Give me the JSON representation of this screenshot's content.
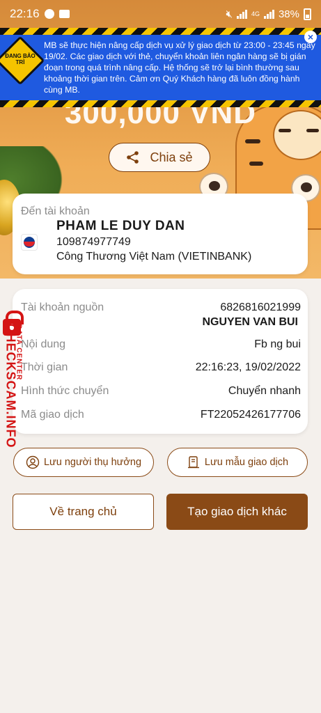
{
  "status_bar": {
    "time": "22:16",
    "battery": "38%",
    "network": "4G"
  },
  "banner": {
    "sign_text": "ĐANG BẢO TRÌ",
    "message": "MB sẽ thực hiện nâng cấp dịch vụ xử lý giao dịch  từ 23:00 - 23:45 ngày 19/02. Các giao dịch với thẻ, chuyển khoản liên ngân hàng sẽ bị gián đoạn trong quá trình nâng cấp. Hệ thống sẽ trở lại bình thường sau khoảng thời gian trên. Cảm ơn Quý Khách hàng đã luôn đồng hành cùng MB.",
    "close": "×"
  },
  "hero": {
    "amount": "300,000 VND",
    "share_label": "Chia sẻ"
  },
  "recipient": {
    "label": "Đến tài khoản",
    "name": "PHAM LE DUY DAN",
    "account_number": "109874977749",
    "bank": "Công Thương Việt Nam (VIETINBANK)"
  },
  "details": {
    "source_label": "Tài khoản nguồn",
    "source_account": "6826816021999",
    "source_holder": "NGUYEN VAN BUI",
    "content_label": "Nội dung",
    "content_value": "Fb ng bui",
    "time_label": "Thời gian",
    "time_value": "22:16:23, 19/02/2022",
    "method_label": "Hình thức chuyển",
    "method_value": "Chuyển nhanh",
    "txn_label": "Mã giao dịch",
    "txn_value": "FT22052426177706"
  },
  "actions": {
    "save_payee": "Lưu người thụ hưởng",
    "save_template": "Lưu mẫu giao dịch",
    "home": "Về trang chủ",
    "new_transaction": "Tạo giao dịch khác"
  },
  "watermark": {
    "main": "CHECKSCAM.INFO",
    "sub": "DATA CENTER"
  },
  "colors": {
    "brand_brown": "#8a4a16",
    "banner_blue": "#1f5ae0",
    "hero_orange": "#e39a45",
    "watermark_red": "#d41414"
  }
}
